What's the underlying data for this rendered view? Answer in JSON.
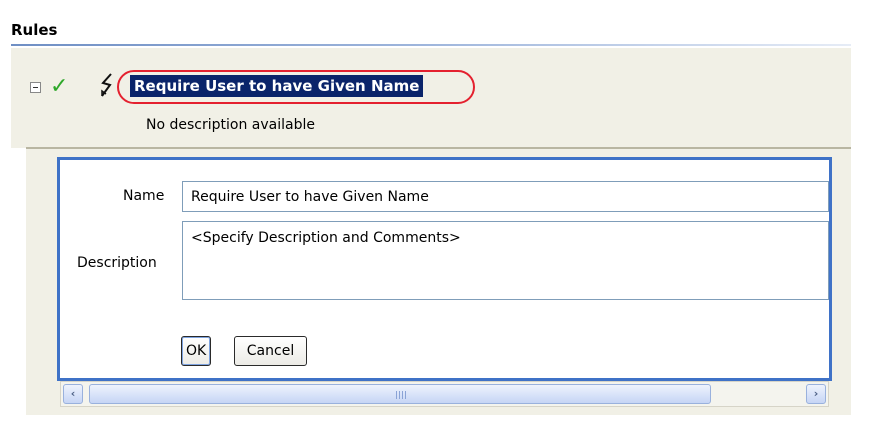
{
  "section": {
    "title": "Rules"
  },
  "rule": {
    "name": "Require User to have Given Name",
    "description_text": "No description available",
    "enabled_icon": "check-icon",
    "rule_icon": "rule-lightning-icon"
  },
  "editor": {
    "name_label": "Name",
    "name_value": "Require User to have Given Name",
    "description_label": "Description",
    "description_value": "<Specify Description and Comments>",
    "ok_label": "OK",
    "cancel_label": "Cancel"
  },
  "scrollbar": {
    "left_arrow": "‹",
    "right_arrow": "›"
  },
  "colors": {
    "selection_bg": "#0a246a",
    "highlight_outline": "#e4212f",
    "editor_border": "#3f72c7",
    "check": "#2fa82a"
  }
}
